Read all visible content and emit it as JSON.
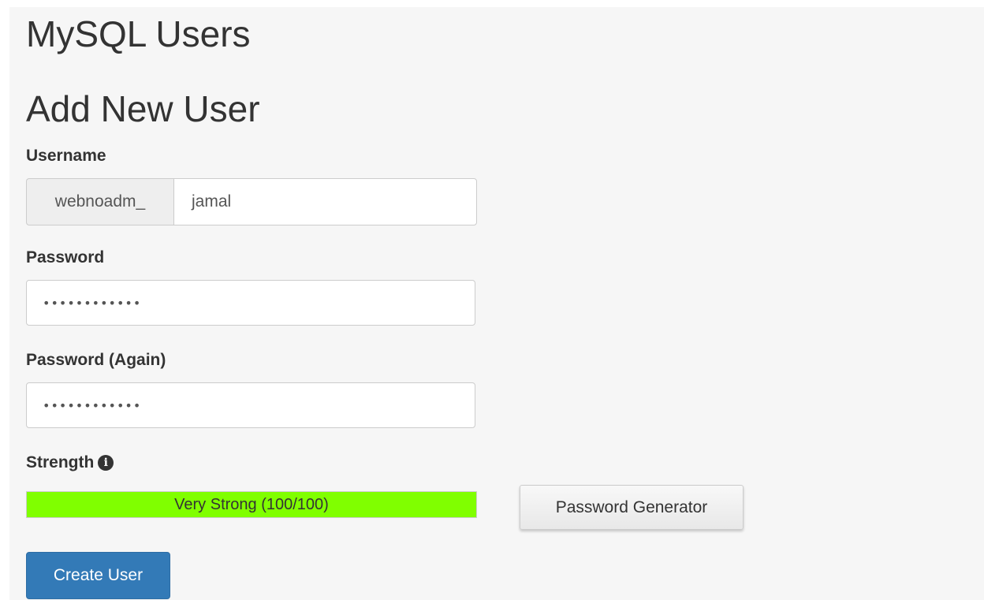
{
  "page": {
    "title": "MySQL Users",
    "section_title": "Add New User"
  },
  "username": {
    "label": "Username",
    "prefix": "webnoadm_",
    "value": "jamal"
  },
  "password": {
    "label": "Password",
    "masked_value": "••••••••••••"
  },
  "password_again": {
    "label": "Password (Again)",
    "masked_value": "••••••••••••"
  },
  "strength": {
    "label": "Strength",
    "info_icon": "info-circle-icon",
    "text": "Very Strong (100/100)",
    "score": 100,
    "max": 100,
    "color": "#80ff00"
  },
  "buttons": {
    "generator_label": "Password Generator",
    "create_label": "Create User",
    "create_color": "#337ab7"
  }
}
